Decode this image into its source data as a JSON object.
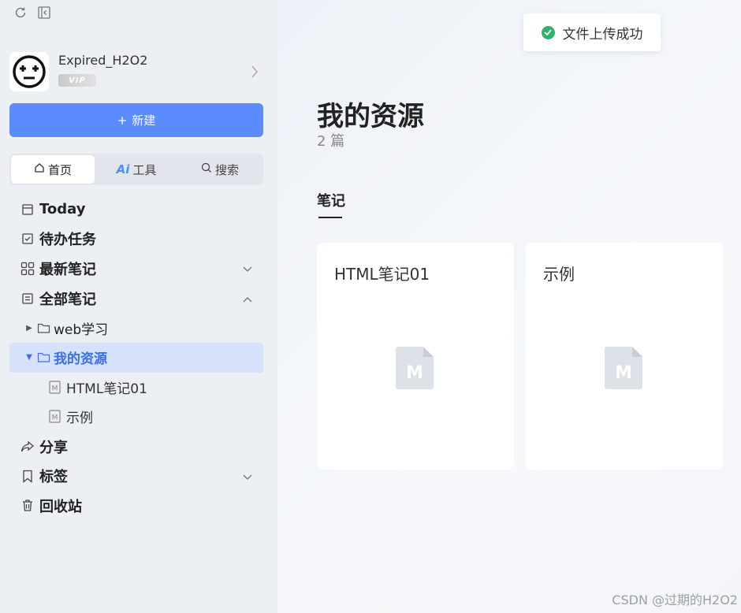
{
  "user": {
    "name": "Expired_H2O2",
    "badge": "VIP"
  },
  "actions": {
    "new_label": "新建"
  },
  "segments": [
    {
      "label": "首页",
      "icon": "home-icon",
      "active": true
    },
    {
      "label": "工具",
      "prefix": "Ai",
      "icon": "ai-icon",
      "active": false
    },
    {
      "label": "搜索",
      "icon": "search-icon",
      "active": false
    }
  ],
  "nav": {
    "today": "Today",
    "todo": "待办任务",
    "recent": "最新笔记",
    "all": "全部笔记",
    "folder_web": "web学习",
    "folder_resources": "我的资源",
    "note_html": "HTML笔记01",
    "note_example": "示例",
    "share": "分享",
    "tags": "标签",
    "trash": "回收站"
  },
  "toast": {
    "text": "文件上传成功",
    "status_color": "#2fb36a"
  },
  "main": {
    "title": "我的资源",
    "count": "2 篇",
    "tab": "笔记",
    "cards": [
      {
        "title": "HTML笔记01",
        "icon": "markdown-file-icon"
      },
      {
        "title": "示例",
        "icon": "markdown-file-icon"
      }
    ]
  },
  "watermark": "CSDN @过期的H2O2",
  "colors": {
    "accent": "#5b8cff",
    "selected_bg": "#d6e1fb",
    "selected_text": "#3b6fe6"
  }
}
